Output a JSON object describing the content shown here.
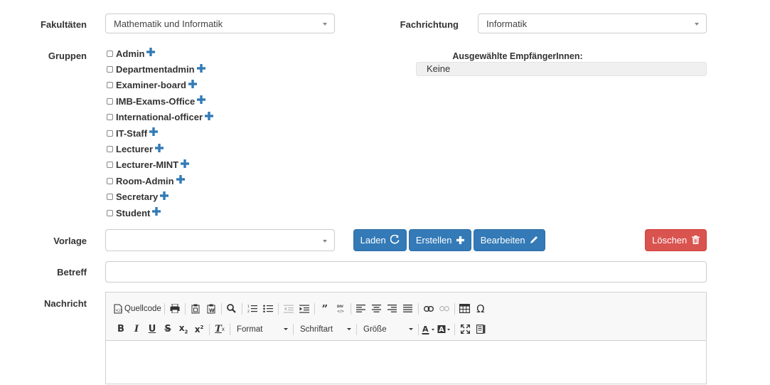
{
  "faculties": {
    "label": "Fakultäten",
    "value": "Mathematik und Informatik"
  },
  "field": {
    "label": "Fachrichtung",
    "value": "Informatik"
  },
  "groups": {
    "label": "Gruppen",
    "items": [
      {
        "label": "Admin",
        "checked": false
      },
      {
        "label": "Departmentadmin",
        "checked": false
      },
      {
        "label": "Examiner-board",
        "checked": false
      },
      {
        "label": "IMB-Exams-Office",
        "checked": false
      },
      {
        "label": "International-officer",
        "checked": false
      },
      {
        "label": "IT-Staff",
        "checked": false
      },
      {
        "label": "Lecturer",
        "checked": false
      },
      {
        "label": "Lecturer-MINT",
        "checked": false
      },
      {
        "label": "Room-Admin",
        "checked": false
      },
      {
        "label": "Secretary",
        "checked": false
      },
      {
        "label": "Student",
        "checked": false
      }
    ],
    "add_icon": "plus-icon"
  },
  "recipients": {
    "title": "Ausgewählte EmpfängerInnen:",
    "value": "Keine"
  },
  "template": {
    "label": "Vorlage",
    "value": "",
    "buttons": {
      "load": "Laden",
      "create": "Erstellen",
      "edit": "Bearbeiten",
      "delete": "Löschen"
    }
  },
  "subject": {
    "label": "Betreff",
    "value": ""
  },
  "message": {
    "label": "Nachricht",
    "toolbar": {
      "source": "Quellcode",
      "format": "Format",
      "font": "Schriftart",
      "size": "Größe"
    }
  },
  "colors": {
    "primary": "#337ab7",
    "danger": "#d9534f",
    "recipient_bg": "#f0f0f0"
  }
}
